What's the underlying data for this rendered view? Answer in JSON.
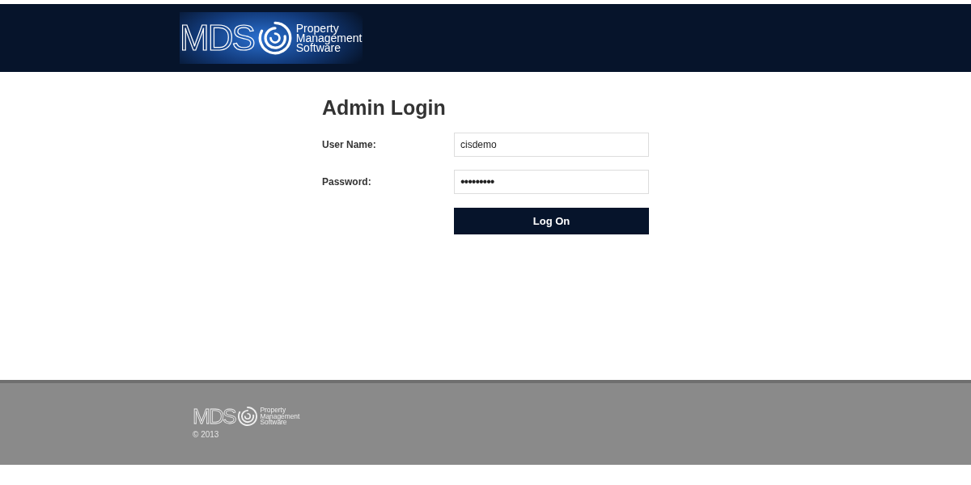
{
  "header": {
    "logo": {
      "mark": "MDS",
      "lines": [
        "Property",
        "Management",
        "Software"
      ]
    }
  },
  "login": {
    "title": "Admin Login",
    "fields": [
      {
        "label": "User Name:",
        "value": "cisdemo"
      },
      {
        "label": "Password:",
        "value": "•••••••••"
      }
    ],
    "button": "Log On"
  },
  "footer": {
    "logo": {
      "mark": "MDS",
      "lines": [
        "Property",
        "Management",
        "Software"
      ]
    },
    "copyright": "© 2013"
  }
}
